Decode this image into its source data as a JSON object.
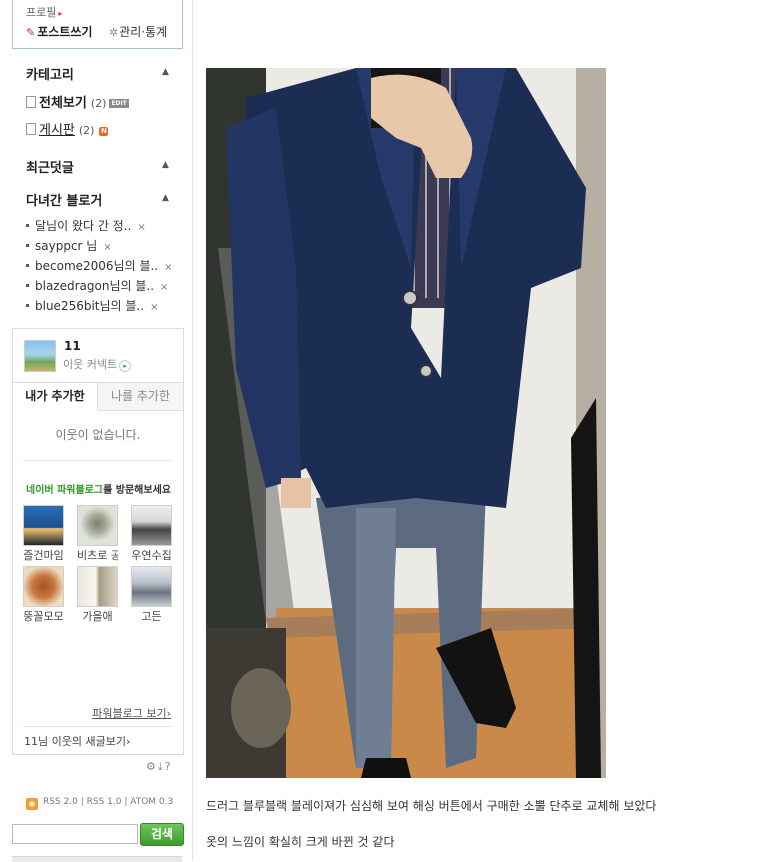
{
  "profile": {
    "label": "프로필",
    "write_post": "포스트쓰기",
    "admin_stats": "관리·통계"
  },
  "category": {
    "title": "카테고리",
    "items": [
      {
        "label": "전체보기",
        "count": "(2)",
        "badge": "EDIT"
      },
      {
        "label": "게시판",
        "count": "(2)",
        "badge": "N"
      }
    ]
  },
  "recent_comments": {
    "title": "최근덧글"
  },
  "visited_bloggers": {
    "title": "다녀간 블로거",
    "items": [
      "달님이 왔다 간 정..",
      "sayppcr 님",
      "become2006님의 블..",
      "blazedragon님의 블..",
      "blue256bit님의 블.."
    ],
    "remove_symbol": "×"
  },
  "neighbors": {
    "count": "11",
    "connect_label": "이웃 커넥트",
    "tabs": [
      "내가 추가한",
      "나를 추가한"
    ],
    "empty_message": "이웃이 없습니다.",
    "power_blog_green": "네이버 파워블로그",
    "power_blog_rest": "를 방문해보세요",
    "thumbs": [
      {
        "caption": "즐건마임",
        "color_a": "#1d4f8a",
        "color_b": "#f4c26b"
      },
      {
        "caption": "비츠로 공",
        "color_a": "#cfd8c9",
        "color_b": "#8b8f7c"
      },
      {
        "caption": "우연수집",
        "color_a": "#e8e8e8",
        "color_b": "#333333"
      },
      {
        "caption": "뚱꼴모모",
        "color_a": "#f2e4cf",
        "color_b": "#b0642d"
      },
      {
        "caption": "가을애",
        "color_a": "#f3f1ea",
        "color_b": "#9c8f77"
      },
      {
        "caption": "고든",
        "color_a": "#d8dde2",
        "color_b": "#6b7580"
      }
    ],
    "power_blog_more": "파워블로그 보기",
    "new_posts": "11님 이웃의 새글보기"
  },
  "rss": {
    "items": [
      "RSS 2.0",
      "RSS 1.0",
      "ATOM 0.3"
    ]
  },
  "search": {
    "placeholder": "",
    "button": "검색"
  },
  "post": {
    "caption_1": "드러그 블루블랙 블레이져가 심심해 보여 해싱 버튼에서 구매한 소뿔 단추로 교체해 보았다",
    "caption_2": "옷의 느낌이 확실히 크게 바뀐 것 같다"
  },
  "colors": {
    "accent_green": "#2e9b22",
    "search_green": "#3f9c2c",
    "badge_orange": "#f26522"
  }
}
